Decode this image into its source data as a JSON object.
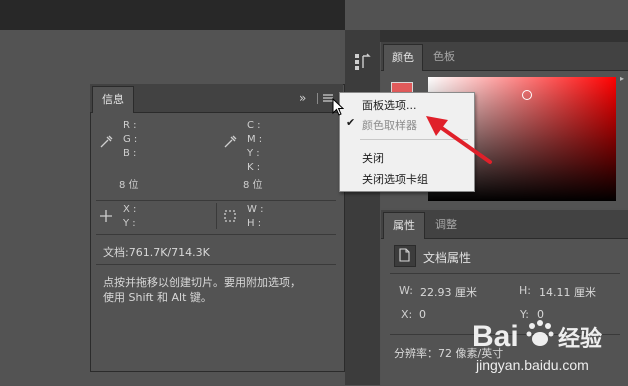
{
  "info_panel": {
    "tab_label": "信息",
    "expand_glyph": "»",
    "rgb_labels": [
      "R :",
      "G :",
      "B :"
    ],
    "cmyk_labels": [
      "C :",
      "M :",
      "Y :",
      "K :"
    ],
    "bit_depth_left": "8 位",
    "bit_depth_right": "8 位",
    "xy_labels": [
      "X :",
      "Y :"
    ],
    "wh_labels": [
      "W :",
      "H :"
    ],
    "doc_size": "文档:761.7K/714.3K",
    "hint_line1": "点按并拖移以创建切片。要用附加选项，",
    "hint_line2": "使用 Shift 和 Alt 键。"
  },
  "context_menu": {
    "items": [
      {
        "label": "面板选项...",
        "checked": false,
        "disabled": false
      },
      {
        "label": "颜色取样器",
        "checked": true,
        "disabled": true
      },
      {
        "label": "关闭",
        "checked": false,
        "disabled": false
      },
      {
        "label": "关闭选项卡组",
        "checked": false,
        "disabled": false
      }
    ]
  },
  "color_panel": {
    "tabs": [
      "颜色",
      "色板"
    ],
    "foreground_color": "#e05a5a"
  },
  "properties_panel": {
    "tabs": [
      "属性",
      "调整"
    ],
    "section_title": "文档属性",
    "w_label": "W:",
    "w_value": "22.93 厘米",
    "h_label": "H:",
    "h_value": "14.11 厘米",
    "x_label": "X:",
    "x_value": "0",
    "y_label": "Y:",
    "y_value": "0",
    "resolution": "分辨率：72 像素/英寸"
  },
  "watermark": {
    "brand": "Bai",
    "brand_suffix": "du",
    "product": "经验",
    "url": "jingyan.baidu.com"
  },
  "colors": {
    "accent_arrow": "#e0202a",
    "panel_bg": "#535353",
    "menu_bg": "#f0f0f0"
  }
}
